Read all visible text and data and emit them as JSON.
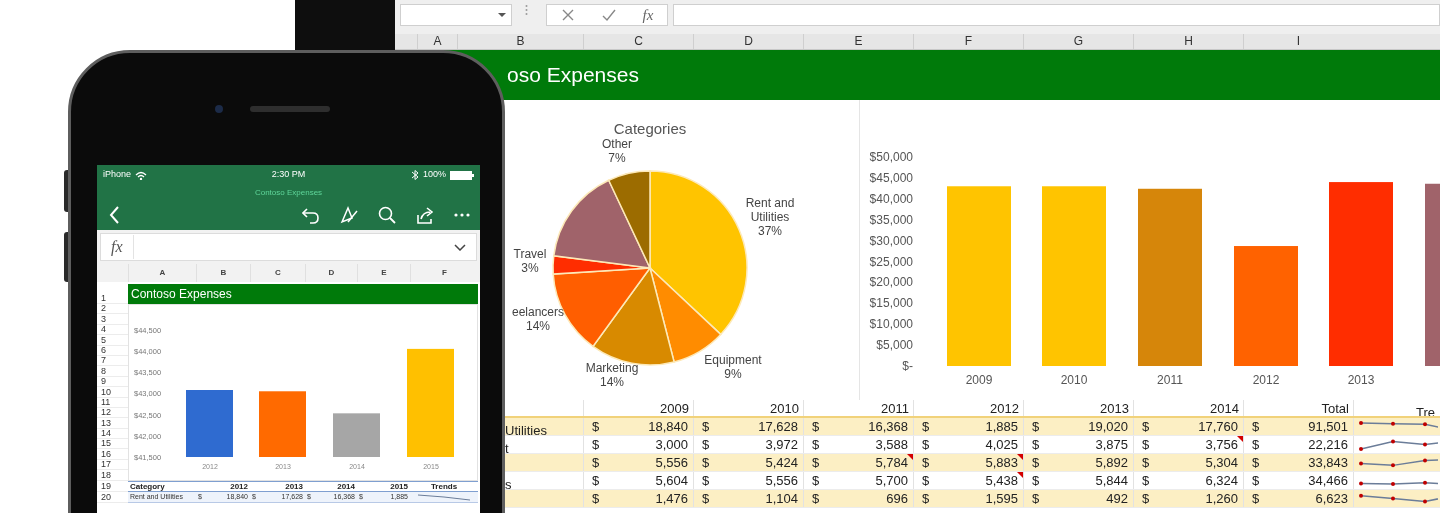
{
  "laptop": {
    "formula_bar": {
      "function_label": "fx"
    },
    "column_headers": [
      "A",
      "B",
      "C",
      "D",
      "E",
      "F",
      "G",
      "H",
      "I"
    ],
    "banner_title": "oso Expenses",
    "pie_chart": {
      "chart_data": {
        "type": "pie",
        "title": "Categories",
        "categories": [
          "Rent and Utilities",
          "Equipment",
          "Marketing",
          "eelancers",
          "Travel",
          null,
          "Other"
        ],
        "values": [
          37,
          9,
          14,
          14,
          3,
          16,
          7
        ],
        "value_labels": [
          "37%",
          "9%",
          "14%",
          "14%",
          "3%",
          null,
          "7%"
        ],
        "colors": [
          "#ffc400",
          "#ff8c00",
          "#d88a00",
          "#ff5e00",
          "#ff2d00",
          "#a0636a",
          "#9c6c00"
        ]
      }
    },
    "bar_chart": {
      "chart_data": {
        "type": "bar",
        "categories": [
          "2009",
          "2010",
          "2011",
          "2012",
          "2013",
          null
        ],
        "values": [
          43000,
          43000,
          42400,
          28700,
          44000,
          43600
        ],
        "colors": [
          "#ffc400",
          "#ffc400",
          "#d6860a",
          "#ff6200",
          "#ff2d00",
          "#a0636a"
        ],
        "ylim": [
          0,
          50000
        ],
        "yticks": [
          {
            "value": 0,
            "label": "$-"
          },
          {
            "value": 5000,
            "label": "$5,000"
          },
          {
            "value": 10000,
            "label": "$10,000"
          },
          {
            "value": 15000,
            "label": "$15,000"
          },
          {
            "value": 20000,
            "label": "$20,000"
          },
          {
            "value": 25000,
            "label": "$25,000"
          },
          {
            "value": 30000,
            "label": "$30,000"
          },
          {
            "value": 35000,
            "label": "$35,000"
          },
          {
            "value": 40000,
            "label": "$40,000"
          },
          {
            "value": 45000,
            "label": "$45,000"
          },
          {
            "value": 50000,
            "label": "$50,000"
          }
        ]
      }
    },
    "table": {
      "columns": [
        "2009",
        "2010",
        "2011",
        "2012",
        "2013",
        "2014",
        "Total",
        "Tre"
      ],
      "rows": [
        {
          "label": "Utilities",
          "cells": [
            {
              "currency": "$",
              "text": "18,840",
              "note": false
            },
            {
              "currency": "$",
              "text": "17,628",
              "note": false
            },
            {
              "currency": "$",
              "text": "16,368",
              "note": false
            },
            {
              "currency": "$",
              "text": "1,885",
              "note": false
            },
            {
              "currency": "$",
              "text": "19,020",
              "note": false
            },
            {
              "currency": "$",
              "text": "17,760",
              "note": false
            },
            {
              "currency": "$",
              "text": "91,501",
              "note": false
            }
          ]
        },
        {
          "label": "t",
          "cells": [
            {
              "currency": "$",
              "text": "3,000",
              "note": false
            },
            {
              "currency": "$",
              "text": "3,972",
              "note": false
            },
            {
              "currency": "$",
              "text": "3,588",
              "note": false
            },
            {
              "currency": "$",
              "text": "4,025",
              "note": false
            },
            {
              "currency": "$",
              "text": "3,875",
              "note": false
            },
            {
              "currency": "$",
              "text": "3,756",
              "note": true
            },
            {
              "currency": "$",
              "text": "22,216",
              "note": false
            }
          ]
        },
        {
          "cells": [
            {
              "currency": "$",
              "text": "5,556",
              "note": false
            },
            {
              "currency": "$",
              "text": "5,424",
              "note": false
            },
            {
              "currency": "$",
              "text": "5,784",
              "note": true
            },
            {
              "currency": "$",
              "text": "5,883",
              "note": true
            },
            {
              "currency": "$",
              "text": "5,892",
              "note": false
            },
            {
              "currency": "$",
              "text": "5,304",
              "note": false
            },
            {
              "currency": "$",
              "text": "33,843",
              "note": false
            }
          ]
        },
        {
          "label": "s",
          "cells": [
            {
              "currency": "$",
              "text": "5,604",
              "note": false
            },
            {
              "currency": "$",
              "text": "5,556",
              "note": false
            },
            {
              "currency": "$",
              "text": "5,700",
              "note": false
            },
            {
              "currency": "$",
              "text": "5,438",
              "note": true
            },
            {
              "currency": "$",
              "text": "5,844",
              "note": false
            },
            {
              "currency": "$",
              "text": "6,324",
              "note": false
            },
            {
              "currency": "$",
              "text": "34,466",
              "note": false
            }
          ]
        },
        {
          "cells": [
            {
              "currency": "$",
              "text": "1,476",
              "note": false
            },
            {
              "currency": "$",
              "text": "1,104",
              "note": false
            },
            {
              "currency": "$",
              "text": "696",
              "note": false
            },
            {
              "currency": "$",
              "text": "1,595",
              "note": false
            },
            {
              "currency": "$",
              "text": "492",
              "note": false
            },
            {
              "currency": "$",
              "text": "1,260",
              "note": false
            },
            {
              "currency": "$",
              "text": "6,623",
              "note": false
            }
          ]
        }
      ]
    }
  },
  "phone": {
    "status_bar": {
      "carrier": "iPhone",
      "time": "2:30 PM",
      "battery": "100%"
    },
    "document_title": "Contoso Expenses",
    "formula_bar": {
      "function_label": "fx"
    },
    "column_headers": [
      "A",
      "B",
      "C",
      "D",
      "E",
      "F"
    ],
    "row_numbers": [
      "1",
      "2",
      "3",
      "4",
      "5",
      "6",
      "7",
      "8",
      "9",
      "10",
      "11",
      "12",
      "13",
      "14",
      "15",
      "16",
      "17",
      "18",
      "19",
      "20"
    ],
    "banner_title": "Contoso Expenses",
    "chart": {
      "chart_data": {
        "type": "bar",
        "categories": [
          "2012",
          "2013",
          "2014",
          "2015"
        ],
        "values": [
          43080,
          43050,
          42530,
          44050
        ],
        "colors": [
          "#2f6bd0",
          "#ff6a00",
          "#a6a6a6",
          "#ffc000"
        ],
        "ylim": [
          41500,
          44500
        ],
        "yticks": [
          {
            "value": 41500,
            "label": "$41,500"
          },
          {
            "value": 42000,
            "label": "$42,000"
          },
          {
            "value": 42500,
            "label": "$42,500"
          },
          {
            "value": 43000,
            "label": "$43,000"
          },
          {
            "value": 43500,
            "label": "$43,500"
          },
          {
            "value": 44000,
            "label": "$44,000"
          },
          {
            "value": 44500,
            "label": "$44,500"
          }
        ]
      }
    },
    "table": {
      "columns": [
        "Category",
        "2012",
        "2013",
        "2014",
        "2015",
        "Trends"
      ],
      "rows": [
        {
          "cells": [
            {
              "text": "Rent and Utilities"
            },
            {
              "currency": "$",
              "text": "18,840"
            },
            {
              "currency": "$",
              "text": "17,628"
            },
            {
              "currency": "$",
              "text": "16,368"
            },
            {
              "currency": "$",
              "text": "1,885"
            }
          ]
        }
      ]
    }
  }
}
